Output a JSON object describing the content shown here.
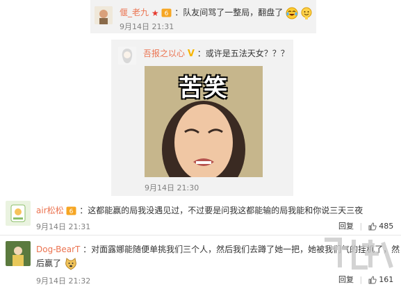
{
  "comments": [
    {
      "username": "偃_老九",
      "text": "：队友间骂了一整局，翻盘了",
      "time": "9月14日 21:31",
      "emoji_icons": [
        "crying-laughing-emoji-icon",
        "smiling-emoji-icon"
      ]
    },
    {
      "username": "吾报之以心",
      "text": "：或许是五法天女？？？",
      "time": "9月14日 21:30",
      "meme_caption": "苦笑"
    },
    {
      "username": "air松松",
      "text": "：这都能赢的局我没遇见过，不过要是问我这都能输的局我能和你说三天三夜",
      "time": "9月14日 21:31",
      "reply_label": "回复",
      "like_count": "485"
    },
    {
      "username": "Dog-BearT",
      "text_line1": "：对面露娜能随便单挑我们三个人，然后我们去蹲了她一把，她被我们气的挂机了，然",
      "text_line2": "后赢了",
      "time": "9月14日 21:32",
      "reply_label": "回复",
      "like_count": "161"
    }
  ],
  "colors": {
    "username": "#eb7350",
    "card_bg": "#f2f2f2",
    "time": "#808080"
  }
}
